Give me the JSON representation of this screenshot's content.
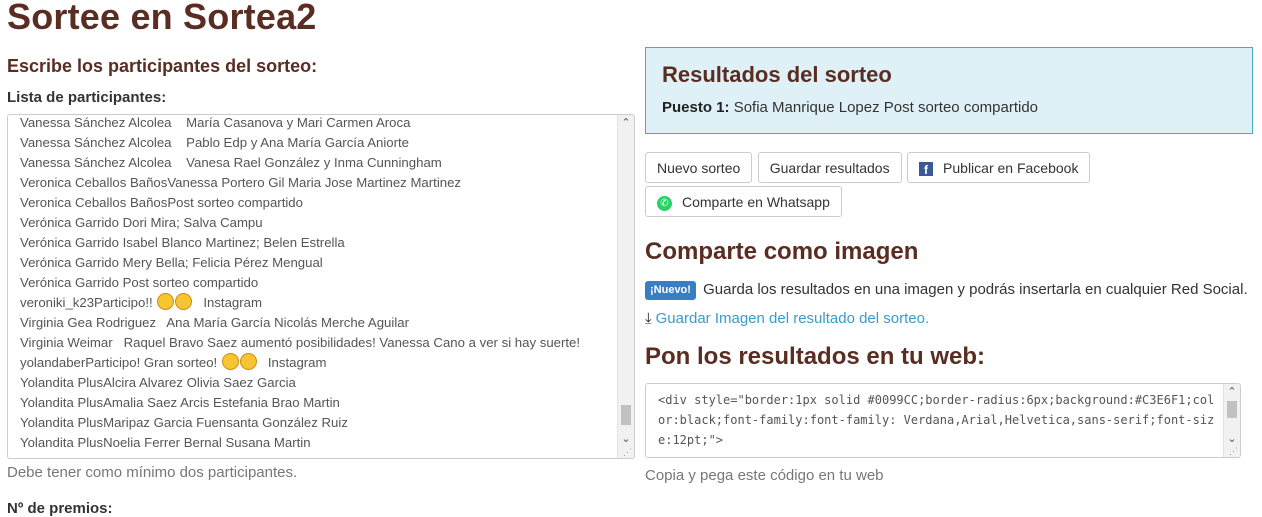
{
  "page": {
    "title": "Sortee en Sortea2"
  },
  "left": {
    "subtitle": "Escribe los participantes del sorteo:",
    "list_label": "Lista de participantes:",
    "participants": [
      "Vanessa Sánchez Alcolea    María Casanova y Mari Carmen Aroca",
      "Vanessa Sánchez Alcolea    Pablo Edp y Ana María García Aniorte",
      "Vanessa Sánchez Alcolea    Vanesa Rael González y Inma Cunningham",
      "Veronica Ceballos BañosVanessa Portero Gil Maria Jose Martinez Martinez",
      "Veronica Ceballos BañosPost sorteo compartido",
      "Verónica Garrido Dori Mira; Salva Campu",
      "Verónica Garrido Isabel Blanco Martinez; Belen Estrella",
      "Verónica Garrido Mery Bella; Felicia Pérez Mengual",
      "Verónica Garrido Post sorteo compartido",
      "veroniki_k23Participo!! ",
      "Virginia Gea Rodriguez   Ana María García Nicolás Merche Aguilar",
      "Virginia Weimar   Raquel Bravo Saez aumentó posibilidades! Vanessa Cano a ver si hay suerte!",
      "yolandaberParticipo! Gran sorteo! ",
      "Yolandita PlusAlcira Alvarez Olivia Saez Garcia",
      "Yolandita PlusAmalia Saez Arcis Estefania Brao Martin",
      "Yolandita PlusMaripaz Garcia Fuensanta González Ruiz",
      "Yolandita PlusNoelia Ferrer Bernal Susana Martin"
    ],
    "instagram_label": "Instagram",
    "help_text": "Debe tener como mínimo dos participantes.",
    "prizes_label": "Nº de premios:"
  },
  "results": {
    "title": "Resultados del sorteo",
    "position_label": "Puesto 1:",
    "winner": "Sofia Manrique Lopez Post sorteo compartido"
  },
  "buttons": {
    "new_draw": "Nuevo sorteo",
    "save_results": "Guardar resultados",
    "facebook": "Publicar en Facebook",
    "whatsapp": "Comparte en Whatsapp"
  },
  "share": {
    "title": "Comparte como imagen",
    "badge": "¡Nuevo!",
    "text": "Guarda los resultados en una imagen y podrás insertarla en cualquier Red Social.",
    "link": "Guardar Imagen del resultado del sorteo."
  },
  "web": {
    "title": "Pon los resultados en tu web:",
    "code": "<div style=\"border:1px solid #0099CC;border-radius:6px;background:#C3E6F1;color:black;font-family:font-family: Verdana,Arial,Helvetica,sans-serif;font-size:12pt;\">",
    "copy_text": "Copia y pega este código en tu web"
  },
  "icons": [
    "facebook-icon",
    "whatsapp-icon",
    "download-icon",
    "emoji-icon"
  ]
}
